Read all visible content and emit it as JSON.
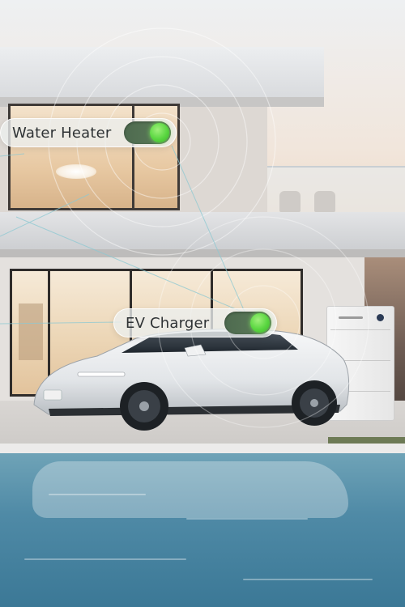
{
  "toggles": [
    {
      "label": "Water Heater",
      "state": "on"
    },
    {
      "label": "EV Charger",
      "state": "on"
    }
  ],
  "colors": {
    "toggle_on": "#59d640",
    "track": "#5d7d5b",
    "card_bg": "#ecf0f0",
    "pool": "#4f8aa6"
  },
  "icons": {
    "signal": "concentric-rings-icon",
    "battery": "home-battery-unit"
  }
}
